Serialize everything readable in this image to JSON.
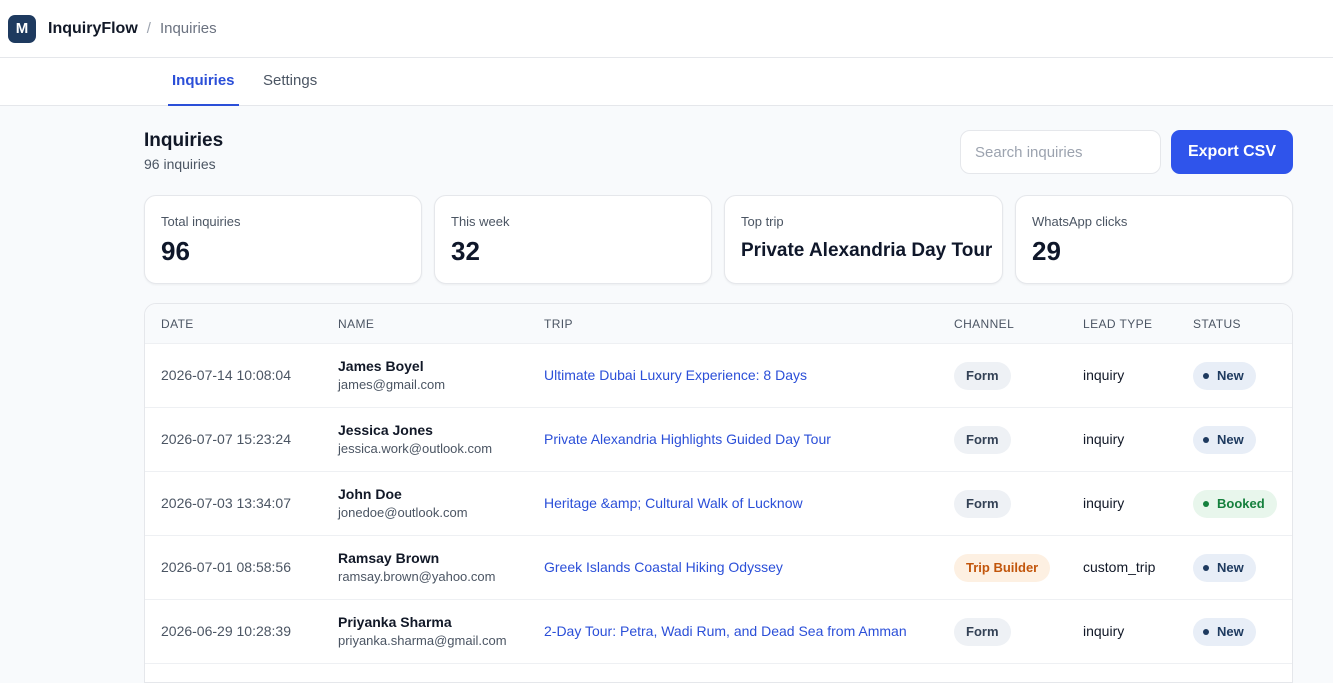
{
  "app": {
    "logo_letter": "M",
    "name": "InquiryFlow",
    "breadcrumb_sep": "/",
    "breadcrumb": "Inquiries"
  },
  "tabs": [
    {
      "label": "Inquiries",
      "active": true
    },
    {
      "label": "Settings",
      "active": false
    }
  ],
  "page": {
    "title": "Inquiries",
    "subtitle": "96 inquiries"
  },
  "search": {
    "placeholder": "Search inquiries",
    "value": ""
  },
  "toolbar": {
    "export_label": "Export CSV"
  },
  "stats": [
    {
      "label": "Total inquiries",
      "value": "96"
    },
    {
      "label": "This week",
      "value": "32"
    },
    {
      "label": "Top trip",
      "value": "Private Alexandria Day Tour"
    },
    {
      "label": "WhatsApp clicks",
      "value": "29"
    }
  ],
  "table": {
    "columns": [
      "DATE",
      "NAME",
      "TRIP",
      "CHANNEL",
      "LEAD TYPE",
      "STATUS"
    ],
    "rows": [
      {
        "date": "2026-07-14 10:08:04",
        "name": "James Boyel",
        "email": "james@gmail.com",
        "trip": "Ultimate Dubai Luxury Experience: 8 Days",
        "channel": "Form",
        "lead_type": "inquiry",
        "status": "New"
      },
      {
        "date": "2026-07-07 15:23:24",
        "name": "Jessica Jones",
        "email": "jessica.work@outlook.com",
        "trip": "Private Alexandria Highlights Guided Day Tour",
        "channel": "Form",
        "lead_type": "inquiry",
        "status": "New"
      },
      {
        "date": "2026-07-03 13:34:07",
        "name": "John Doe",
        "email": "jonedoe@outlook.com",
        "trip": "Heritage &amp; Cultural Walk of Lucknow",
        "channel": "Form",
        "lead_type": "inquiry",
        "status": "Booked"
      },
      {
        "date": "2026-07-01 08:58:56",
        "name": "Ramsay Brown",
        "email": "ramsay.brown@yahoo.com",
        "trip": "Greek Islands Coastal Hiking Odyssey",
        "channel": "Trip Builder",
        "lead_type": "custom_trip",
        "status": "New"
      },
      {
        "date": "2026-06-29 10:28:39",
        "name": "Priyanka Sharma",
        "email": "priyanka.sharma@gmail.com",
        "trip": "2-Day Tour: Petra, Wadi Rum, and Dead Sea from Amman",
        "channel": "Form",
        "lead_type": "inquiry",
        "status": "New"
      }
    ]
  },
  "colors": {
    "accent": "#2f54eb",
    "link": "#2b4fd8",
    "logo_bg": "#1e3a5f",
    "status_new": "#1e3a5f",
    "status_booked": "#15803d",
    "trip_builder": "#c2560c"
  }
}
